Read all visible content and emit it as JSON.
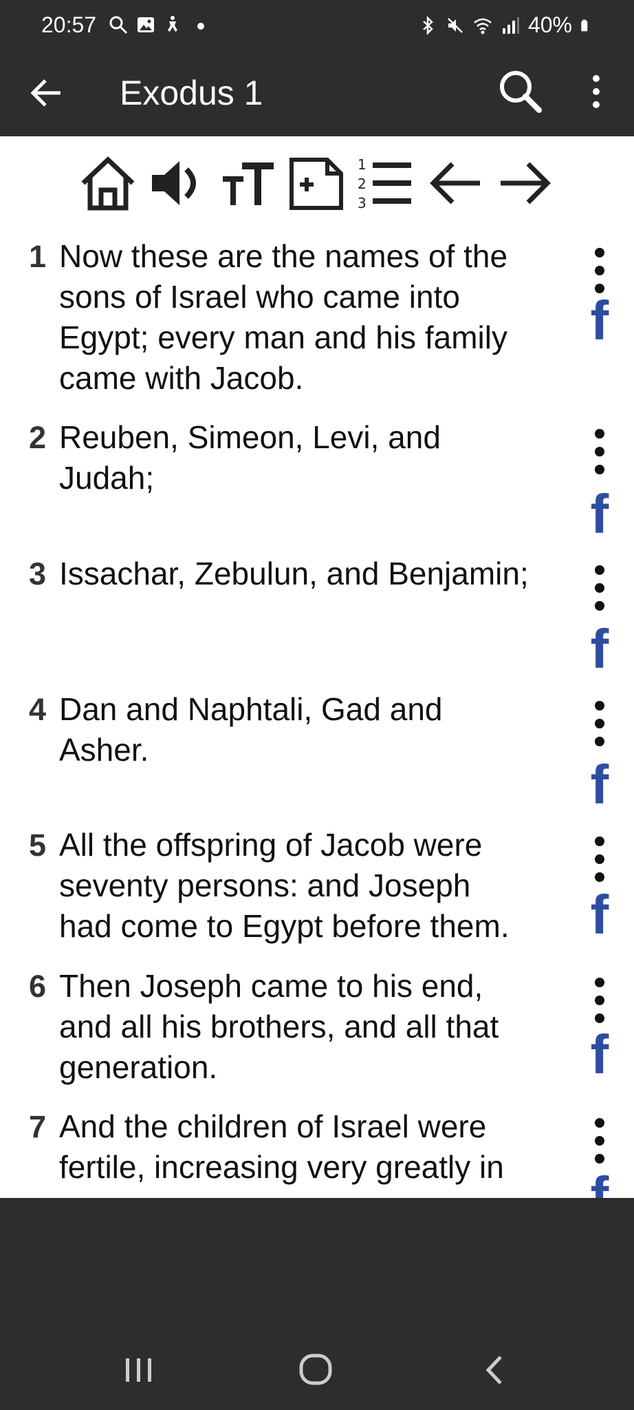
{
  "status_bar": {
    "time": "20:57",
    "battery": "40%",
    "left_icons": [
      "search-icon",
      "gallery-icon",
      "accessibility-icon",
      "notification-dot-icon"
    ],
    "right_icons": [
      "bluetooth-icon",
      "mute-icon",
      "wifi-icon",
      "signal-icon",
      "battery-icon"
    ]
  },
  "app_bar": {
    "title": "Exodus 1"
  },
  "toolbar": {
    "icons": [
      "home-icon",
      "audio-icon",
      "text-size-icon",
      "add-bookmark-icon",
      "verse-list-icon",
      "previous-chapter-icon",
      "next-chapter-icon"
    ]
  },
  "verses": [
    {
      "num": "1",
      "lines": [
        "Now these are the names of the",
        "sons of Israel who came into",
        "Egypt; every man and his family",
        "came with Jacob."
      ]
    },
    {
      "num": "2",
      "lines": [
        "Reuben, Simeon, Levi, and",
        "Judah;"
      ]
    },
    {
      "num": "3",
      "lines": [
        "Issachar, Zebulun, and Benjamin;"
      ]
    },
    {
      "num": "4",
      "lines": [
        "Dan and Naphtali, Gad and",
        "Asher."
      ]
    },
    {
      "num": "5",
      "lines": [
        "All the offspring of Jacob were",
        "seventy persons: and Joseph",
        "had come to Egypt before them."
      ]
    },
    {
      "num": "6",
      "lines": [
        "Then Joseph came to his end,",
        "and all his brothers, and all that",
        "generation."
      ]
    },
    {
      "num": "7",
      "lines": [
        "And the children of Israel were",
        "fertile, increasing very greatly in"
      ]
    }
  ],
  "share_icon_text": "f",
  "nav": {
    "icons": [
      "recent-apps-icon",
      "home-circle-icon",
      "back-icon"
    ]
  },
  "colors": {
    "bar": "#2d2d2d",
    "facebook": "#2f4da0",
    "content_bg": "#ffffff"
  }
}
